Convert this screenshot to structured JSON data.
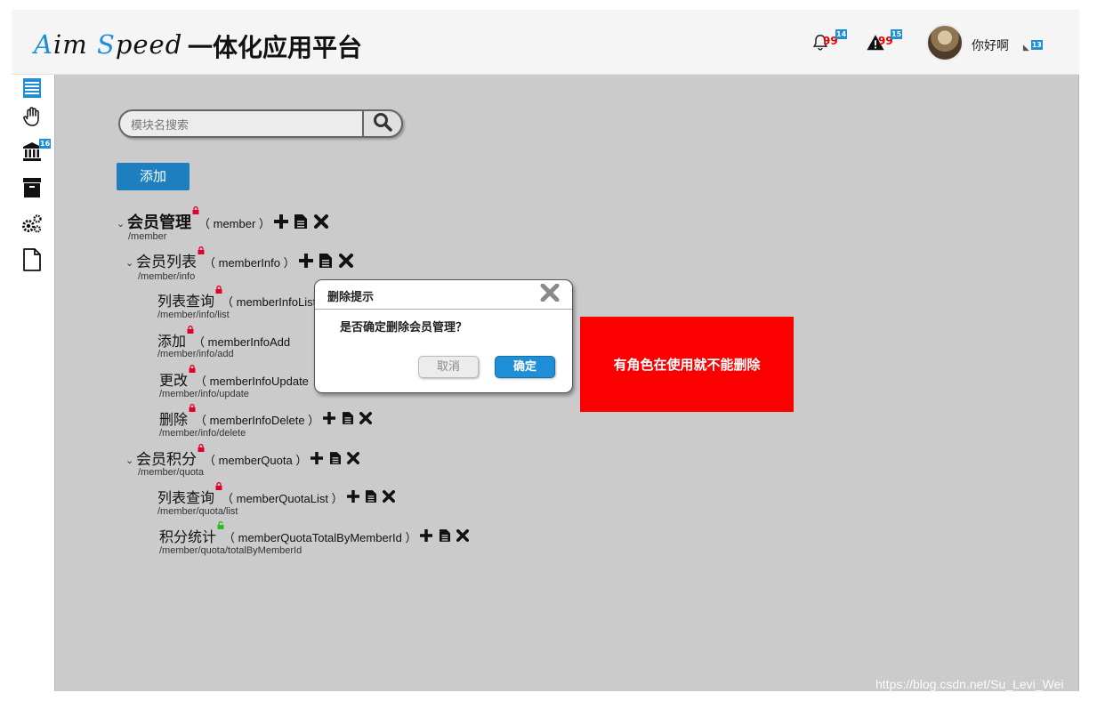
{
  "header": {
    "logo_a": "A",
    "logo_im": "im ",
    "logo_s": "S",
    "logo_peed": "peed",
    "title": "一体化应用平台",
    "notifications": {
      "icon": "bell-icon",
      "count": "99",
      "badge": "14"
    },
    "alerts": {
      "icon": "warning-icon",
      "count": "99",
      "badge": "15"
    },
    "user": {
      "name": "你好啊",
      "badge": "13"
    }
  },
  "sidebar": {
    "items": [
      {
        "icon": "list-icon"
      },
      {
        "icon": "hand-icon"
      },
      {
        "icon": "bank-icon",
        "badge": "16"
      },
      {
        "icon": "archive-icon"
      },
      {
        "icon": "gears-icon"
      },
      {
        "icon": "file-icon"
      }
    ]
  },
  "search": {
    "placeholder": "模块名搜索"
  },
  "add_button": "添加",
  "tree": [
    {
      "name": "会员管理",
      "code": "（ member ）",
      "path": "/member",
      "lock": "red"
    },
    {
      "name": "会员列表",
      "code": "（ memberInfo ）",
      "path": "/member/info",
      "lock": "red"
    },
    {
      "name": "列表查询",
      "code": "（ memberInfoList",
      "path": "/member/info/list",
      "lock": "red"
    },
    {
      "name": "添加",
      "code": "（ memberInfoAdd",
      "path": "/member/info/add",
      "lock": "red"
    },
    {
      "name": "更改",
      "code": "（ memberInfoUpdate",
      "path": "/member/info/update",
      "lock": "red"
    },
    {
      "name": "删除",
      "code": "（ memberInfoDelete ）",
      "path": "/member/info/delete",
      "lock": "red"
    },
    {
      "name": "会员积分",
      "code": "（ memberQuota ）",
      "path": "/member/quota",
      "lock": "red"
    },
    {
      "name": "列表查询",
      "code": "（ memberQuotaList ）",
      "path": "/member/quota/list",
      "lock": "red"
    },
    {
      "name": "积分统计",
      "code": "（ memberQuotaTotalByMemberId ）",
      "path": "/member/quota/totalByMemberId",
      "lock": "green"
    }
  ],
  "dialog": {
    "title": "删除提示",
    "message": "是否确定删除会员管理？",
    "cancel": "取消",
    "confirm": "确定"
  },
  "note": "有角色在使用就不能删除",
  "watermark": "https://blog.csdn.net/Su_Levi_Wei",
  "colors": {
    "accent": "#1e8fd6",
    "note_bg": "#fb0000",
    "lock_red": "#e0002a",
    "lock_green": "#2cb82c"
  }
}
